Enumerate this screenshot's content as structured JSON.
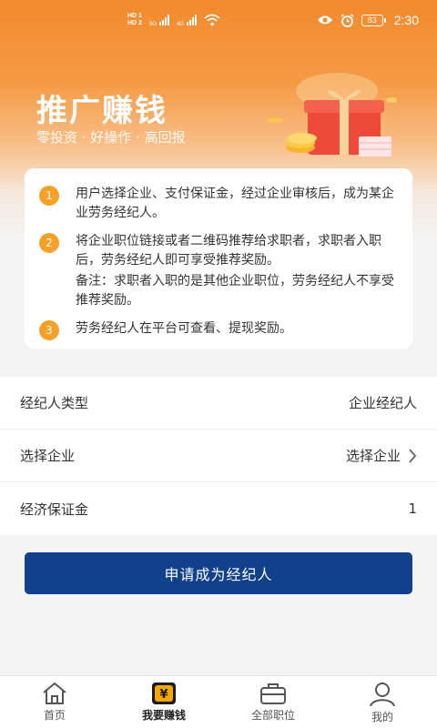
{
  "status_bar": {
    "hd1": "HD 1",
    "hd2": "HD 2",
    "net1": "5G",
    "net2": "4G",
    "battery": "83",
    "time": "2:30"
  },
  "hero": {
    "title": "推广赚钱",
    "subtitle": "零投资 · 好操作 · 高回报"
  },
  "steps": [
    {
      "num": "1",
      "text": "用户选择企业、支付保证金，经过企业审核后，成为某企业劳务经纪人。"
    },
    {
      "num": "2",
      "text": "将企业职位链接或者二维码推荐给求职者，求职者入职后，劳务经纪人即可享受推荐奖励。",
      "note": "备注：求职者入职的是其他企业职位，劳务经纪人不享受推荐奖励。"
    },
    {
      "num": "3",
      "text": "劳务经纪人在平台可查看、提现奖励。"
    }
  ],
  "form": {
    "agent_type_label": "经纪人类型",
    "agent_type_value": "企业经纪人",
    "select_company_label": "选择企业",
    "select_company_value": "选择企业",
    "deposit_label": "经济保证金",
    "deposit_value": "1"
  },
  "submit_label": "申请成为经纪人",
  "tabs": [
    {
      "label": "首页",
      "icon": "home-icon"
    },
    {
      "label": "我要赚钱",
      "icon": "wallet-yen-icon",
      "active": true
    },
    {
      "label": "全部职位",
      "icon": "briefcase-icon"
    },
    {
      "label": "我的",
      "icon": "user-icon"
    }
  ],
  "colors": {
    "hero_orange": "#f28a2e",
    "step_badge": "#f5a026",
    "primary_button": "#11418c",
    "wallet_icon": "#f2a800"
  }
}
